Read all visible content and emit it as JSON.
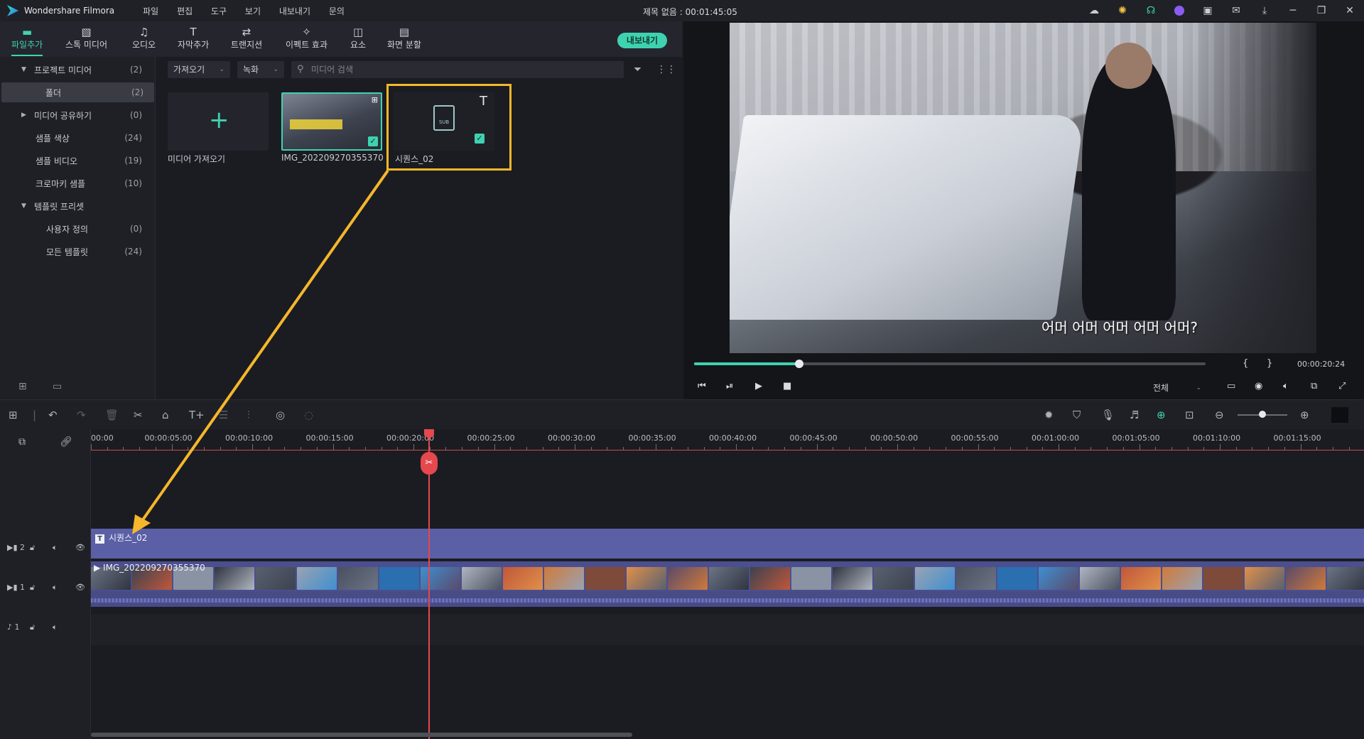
{
  "app": {
    "name": "Wondershare Filmora",
    "project_title": "제목 없음 : 00:01:45:05",
    "menu": [
      "파일",
      "편집",
      "도구",
      "보기",
      "내보내기",
      "문의"
    ]
  },
  "toolbar": {
    "items": [
      {
        "label": "파일추가",
        "icon": "folder-icon"
      },
      {
        "label": "스톡 미디어",
        "icon": "stock-media-icon"
      },
      {
        "label": "오디오",
        "icon": "music-note-icon"
      },
      {
        "label": "자막추가",
        "icon": "text-icon"
      },
      {
        "label": "트랜지션",
        "icon": "transition-icon"
      },
      {
        "label": "이펙트 효과",
        "icon": "effects-icon"
      },
      {
        "label": "요소",
        "icon": "elements-icon"
      },
      {
        "label": "화면 분할",
        "icon": "split-screen-icon"
      }
    ],
    "active_index": 0,
    "export_label": "내보내기",
    "accent_color": "#3fd2b0"
  },
  "sidebar": {
    "items": [
      {
        "label": "프로젝트 미디어",
        "count": "(2)",
        "arrow": "▼"
      },
      {
        "label": "폴더",
        "count": "(2)",
        "arrow": ""
      },
      {
        "label": "미디어 공유하기",
        "count": "(0)",
        "arrow": "▶"
      },
      {
        "label": "샘플 색상",
        "count": "(24)",
        "arrow": ""
      },
      {
        "label": "샘플 비디오",
        "count": "(19)",
        "arrow": ""
      },
      {
        "label": "크로마키 샘플",
        "count": "(10)",
        "arrow": ""
      },
      {
        "label": "템플릿 프리셋",
        "count": "",
        "arrow": "▼"
      },
      {
        "label": "사용자 정의",
        "count": "(0)",
        "arrow": ""
      },
      {
        "label": "모든 템플릿",
        "count": "(24)",
        "arrow": ""
      }
    ],
    "selected_index": 1
  },
  "media": {
    "import_dropdown": "가져오기",
    "record_dropdown": "녹화",
    "search_placeholder": "미디어 검색",
    "import_tile_label": "미디어 가져오기",
    "clips": [
      {
        "name": "IMG_20220927035537​0",
        "type": "video"
      },
      {
        "name": "시퀀스_02",
        "type": "subtitle"
      }
    ]
  },
  "preview": {
    "subtitle_text": "어머 어머 어머 어머 어머?",
    "timecode": "00:00:20:24",
    "progress": 0.205,
    "zoom_select": "전체",
    "mark_in": "{",
    "mark_out": "}"
  },
  "timeline": {
    "ruler_labels": [
      "00:00",
      "00:00:05:00",
      "00:00:10:00",
      "00:00:15:00",
      "00:00:20:00",
      "00:00:25:00",
      "00:00:30:00",
      "00:00:35:00",
      "00:00:40:00",
      "00:00:45:00",
      "00:00:50:00",
      "00:00:55:00",
      "00:01:00:00",
      "00:01:05:00",
      "00:01:10:00",
      "00:01:15:00"
    ],
    "playhead_time": "00:00:20:00",
    "tracks": [
      {
        "id": "2",
        "kind": "video",
        "clip_label": "시퀀스_02"
      },
      {
        "id": "1",
        "kind": "video",
        "clip_label": "IMG_20220927035537​0"
      },
      {
        "id": "1",
        "kind": "audio",
        "clip_label": ""
      }
    ],
    "subtitle_clip_color": "#5b5fa6",
    "video_clip_color": "#4b4f8e",
    "playhead_color": "#e5484d"
  },
  "annotation": {
    "highlight_color": "#f5b72b"
  }
}
